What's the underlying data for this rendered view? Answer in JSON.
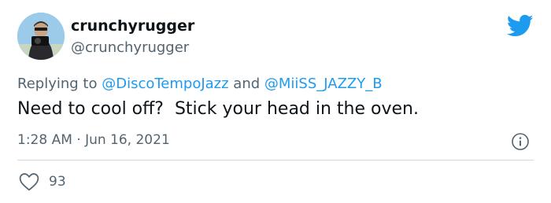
{
  "author": {
    "display_name": "crunchyrugger",
    "handle": "@crunchyrugger",
    "avatar_icon": "avatar-photo"
  },
  "reply": {
    "prefix": "Replying to ",
    "mention_1": "@DiscoTempoJazz",
    "joiner": " and ",
    "mention_2": "@MiiSS_JAZZY_B"
  },
  "tweet": {
    "text": "Need to cool off?  Stick your head in the oven.",
    "timestamp": "1:28 AM · Jun 16, 2021"
  },
  "stats": {
    "likes": "93",
    "like_icon": "heart-outline-icon",
    "info_icon": "info-icon"
  },
  "brand": {
    "logo_icon": "twitter-bird-icon",
    "accent": "#1d9bf0",
    "text": "#0f1419",
    "secondary_text": "#536471",
    "divider": "#cfd9de"
  }
}
